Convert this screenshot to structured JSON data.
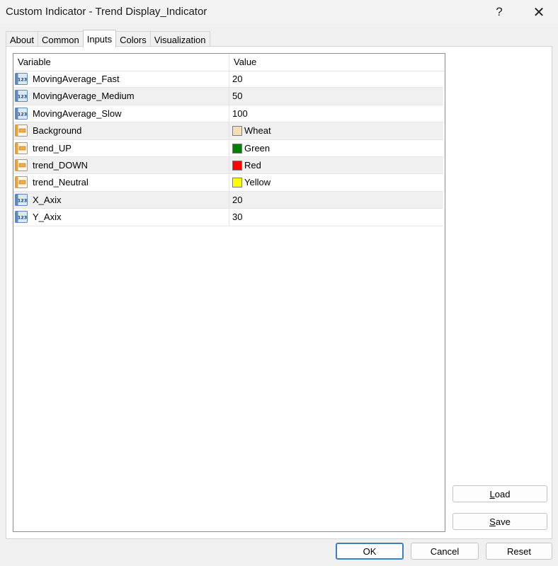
{
  "window": {
    "title": "Custom Indicator - Trend Display_Indicator",
    "help_glyph": "?",
    "close_glyph": "✕"
  },
  "tabs": [
    {
      "label": "About",
      "active": false
    },
    {
      "label": "Common",
      "active": false
    },
    {
      "label": "Inputs",
      "active": true
    },
    {
      "label": "Colors",
      "active": false
    },
    {
      "label": "Visualization",
      "active": false
    }
  ],
  "table": {
    "header": {
      "variable": "Variable",
      "value": "Value"
    },
    "rows": [
      {
        "type": "number-icon",
        "name": "MovingAverage_Fast",
        "value": "20"
      },
      {
        "type": "number-icon",
        "name": "MovingAverage_Medium",
        "value": "50"
      },
      {
        "type": "number-icon",
        "name": "MovingAverage_Slow",
        "value": "100"
      },
      {
        "type": "color-icon",
        "name": "Background",
        "value": "Wheat",
        "color": "#F5DEB3"
      },
      {
        "type": "color-icon",
        "name": "trend_UP",
        "value": "Green",
        "color": "#008000"
      },
      {
        "type": "color-icon",
        "name": "trend_DOWN",
        "value": "Red",
        "color": "#FF0000"
      },
      {
        "type": "color-icon",
        "name": "trend_Neutral",
        "value": "Yellow",
        "color": "#FFFF00"
      },
      {
        "type": "number-icon",
        "name": "X_Axix",
        "value": "20"
      },
      {
        "type": "number-icon",
        "name": "Y_Axix",
        "value": "30"
      }
    ]
  },
  "buttons": {
    "load_first": "L",
    "load_rest": "oad",
    "save_first": "S",
    "save_rest": "ave",
    "ok": "OK",
    "cancel": "Cancel",
    "reset": "Reset"
  },
  "colors": {
    "accent": "#3c7fc1"
  }
}
